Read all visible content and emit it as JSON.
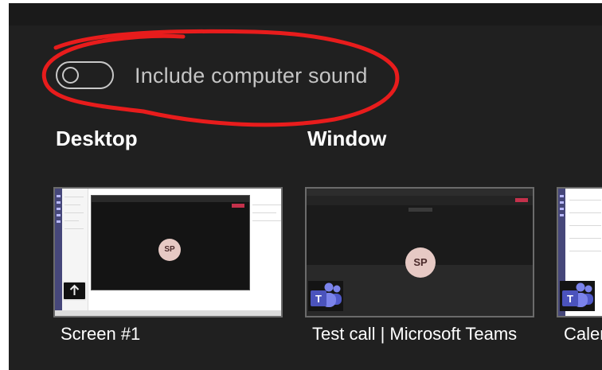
{
  "audio": {
    "toggle_on": false,
    "label": "Include computer sound"
  },
  "sections": {
    "desktop_title": "Desktop",
    "window_title": "Window"
  },
  "thumbnails": [
    {
      "caption": "Screen #1",
      "kind": "screen",
      "avatar": "SP"
    },
    {
      "caption": "Test call | Microsoft Teams",
      "kind": "window",
      "avatar": "SP",
      "icon": "teams-icon"
    },
    {
      "caption": "Caler",
      "kind": "window",
      "icon": "teams-icon"
    }
  ],
  "colors": {
    "panel_bg": "#202020",
    "annotation_red": "#e81c1c",
    "teams_purple": "#5059c9"
  }
}
